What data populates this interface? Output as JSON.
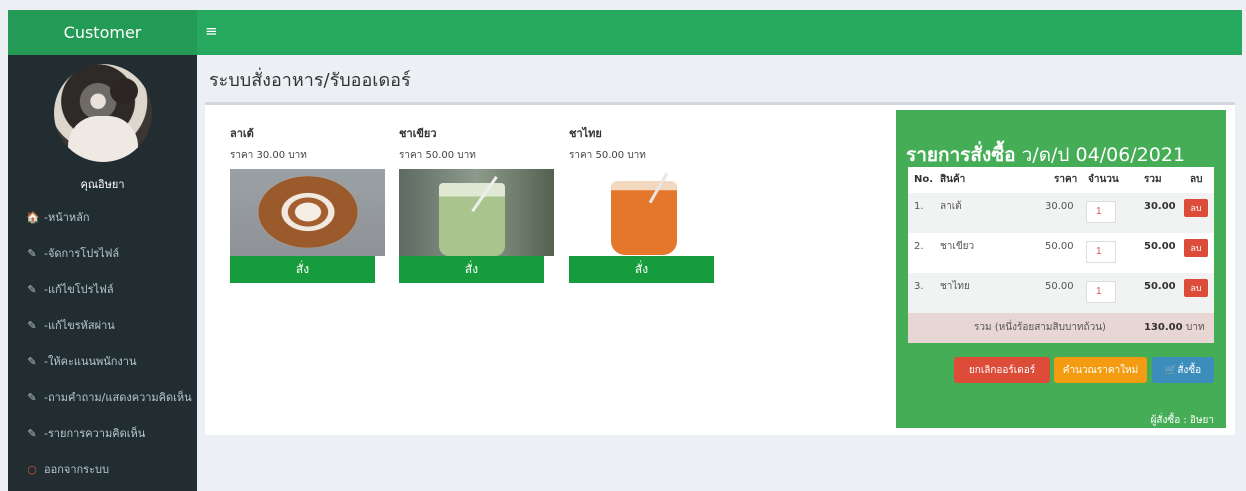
{
  "sidebar": {
    "brand": "Customer",
    "user_name": "คุณอิษยา",
    "items": [
      {
        "icon": "home-icon",
        "glyph": "🏠",
        "label": "-หน้าหลัก"
      },
      {
        "icon": "edit-icon",
        "glyph": "✎",
        "label": "-จัดการโปรไฟล์"
      },
      {
        "icon": "edit-icon",
        "glyph": "✎",
        "label": "-แก้ไขโปรไฟล์"
      },
      {
        "icon": "edit-icon",
        "glyph": "✎",
        "label": "-แก้ไขรหัสผ่าน"
      },
      {
        "icon": "edit-icon",
        "glyph": "✎",
        "label": "-ให้คะแนนพนักงาน"
      },
      {
        "icon": "edit-icon",
        "glyph": "✎",
        "label": "-ถามคำถาม/แสดงความคิดเห็น"
      },
      {
        "icon": "edit-icon",
        "glyph": "✎",
        "label": "-รายการความคิดเห็น"
      },
      {
        "icon": "logout-circle-icon",
        "glyph": "○",
        "label": "ออกจากระบบ"
      }
    ]
  },
  "header": {
    "toggle_glyph": "≡"
  },
  "page": {
    "title": "ระบบสั่งอาหาร/รับออเดอร์"
  },
  "products": [
    {
      "name": "ลาเต้",
      "price": "ราคา 30.00 บาท",
      "button": "สั่ง"
    },
    {
      "name": "ชาเขียว",
      "price": "ราคา 50.00 บาท",
      "button": "สั่ง"
    },
    {
      "name": "ชาไทย",
      "price": "ราคา 50.00 บาท",
      "button": "สั่ง"
    }
  ],
  "order": {
    "title_bold": "รายการสั่งซื้อ",
    "title_date": " ว/ด/ป 04/06/2021",
    "headers": {
      "no": "No.",
      "item": "สินค้า",
      "price": "ราคา",
      "qty": "จำนวน",
      "total": "รวม",
      "delete": "ลบ"
    },
    "rows": [
      {
        "no": "1.",
        "item": "ลาเต้",
        "price": "30.00",
        "qty": "1",
        "total": "30.00",
        "delete": "ลบ"
      },
      {
        "no": "2.",
        "item": "ชาเขียว",
        "price": "50.00",
        "qty": "1",
        "total": "50.00",
        "delete": "ลบ"
      },
      {
        "no": "3.",
        "item": "ชาไทย",
        "price": "50.00",
        "qty": "1",
        "total": "50.00",
        "delete": "ลบ"
      }
    ],
    "grand_label": "รวม (หนึ่งร้อยสามสิบบาทถ้วน)",
    "grand_total": "130.00",
    "currency": "บาท",
    "cancel_button": "ยกเลิกออร์เดอร์",
    "recalc_button": "คำนวณราคาใหม่",
    "buy_button": "สั่งซื้อ",
    "cart_glyph": "🛒",
    "orderer": "ผู้สั่งซื้อ : อิษยา"
  },
  "colors": {
    "header": "#27a85f",
    "sidebar": "#222d32",
    "panel": "#45ad55",
    "order_button": "#179c3d"
  }
}
